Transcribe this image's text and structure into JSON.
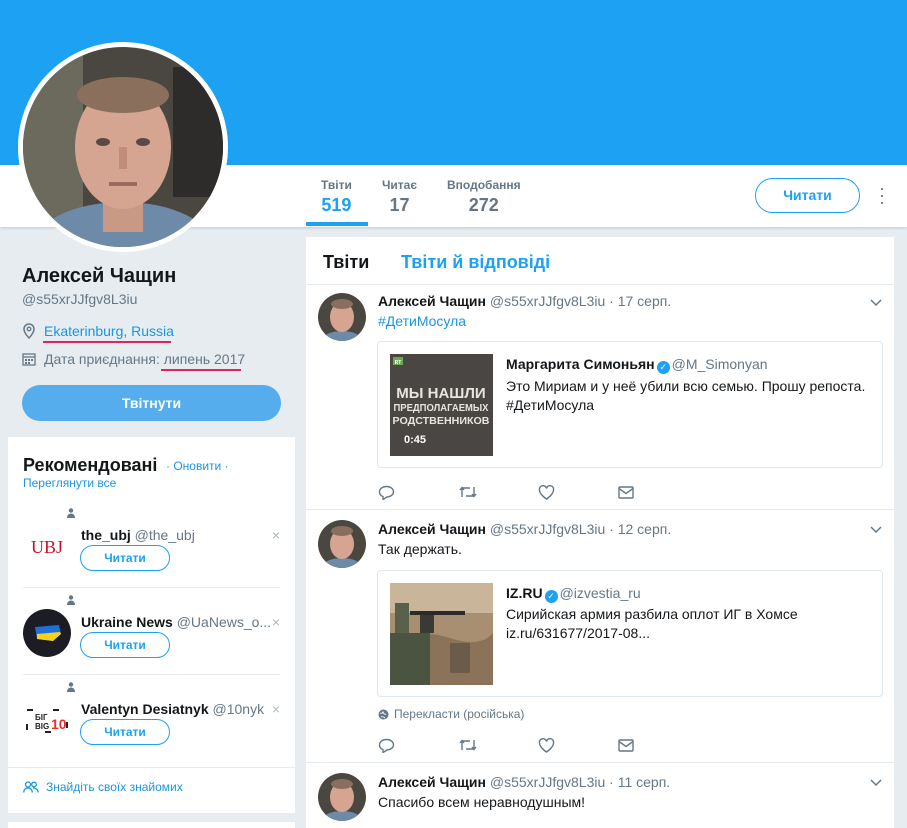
{
  "profile": {
    "name": "Алексей Чащин",
    "handle": "@s55xrJJfgv8L3iu",
    "location": "Ekaterinburg, Russia",
    "joined_label": "Дата приєднання:",
    "joined_date": "липень 2017"
  },
  "stats": [
    {
      "label": "Твіти",
      "value": "519"
    },
    {
      "label": "Читає",
      "value": "17"
    },
    {
      "label": "Вподобання",
      "value": "272"
    }
  ],
  "follow_button": "Читати",
  "tweet_button": "Твітнути",
  "recommended": {
    "title": "Рекомендовані",
    "refresh": "· Оновити ·",
    "view_all": "Переглянути все",
    "follow_label": "Читати",
    "items": [
      {
        "name": "the_ubj",
        "handle": "@the_ubj",
        "logo": "UBJ"
      },
      {
        "name": "Ukraine News",
        "handle": "@UaNews_o..."
      },
      {
        "name": "Valentyn Desiatnyk",
        "handle": "@10nyk",
        "logo_top": "БІГ",
        "logo_bottom": "BIG",
        "logo_num": "10"
      }
    ],
    "find_friends": "Знайдіть своїх знайомих"
  },
  "tabs": {
    "tweets": "Твіти",
    "tweets_replies": "Твіти й відповіді"
  },
  "tweets": [
    {
      "name": "Алексей Чащин",
      "meta": "@s55xrJJfgv8L3iu · 17 серп.",
      "text": "#ДетиМосула",
      "quote": {
        "name": "Маргарита Симоньян",
        "handle": "@M_Simonyan",
        "text1": "Это Мириам и у неё убили всю семью. Прошу репоста.",
        "text2": "#ДетиМосула",
        "thumb_lines": [
          "МЫ НАШЛИ",
          "ПРЕДПОЛАГАЕМЫХ",
          "РОДСТВЕННИКОВ"
        ],
        "duration": "0:45",
        "badge": "RT"
      }
    },
    {
      "name": "Алексей Чащин",
      "meta": "@s55xrJJfgv8L3iu · 12 серп.",
      "text": "Так держать.",
      "quote": {
        "name": "IZ.RU",
        "handle": "@izvestia_ru",
        "text1": "Сирийская армия разбила оплот ИГ в Хомсе",
        "text2": "iz.ru/631677/2017-08..."
      },
      "translate": "Перекласти (російська)"
    },
    {
      "name": "Алексей Чащин",
      "meta": "@s55xrJJfgv8L3iu · 11 серп.",
      "text": "Спасибо всем неравнодушным!"
    }
  ],
  "colors": {
    "accent": "#1da1f2",
    "link": "#1b95e0",
    "underline": "#e0245e",
    "background": "#e6ecf0"
  }
}
